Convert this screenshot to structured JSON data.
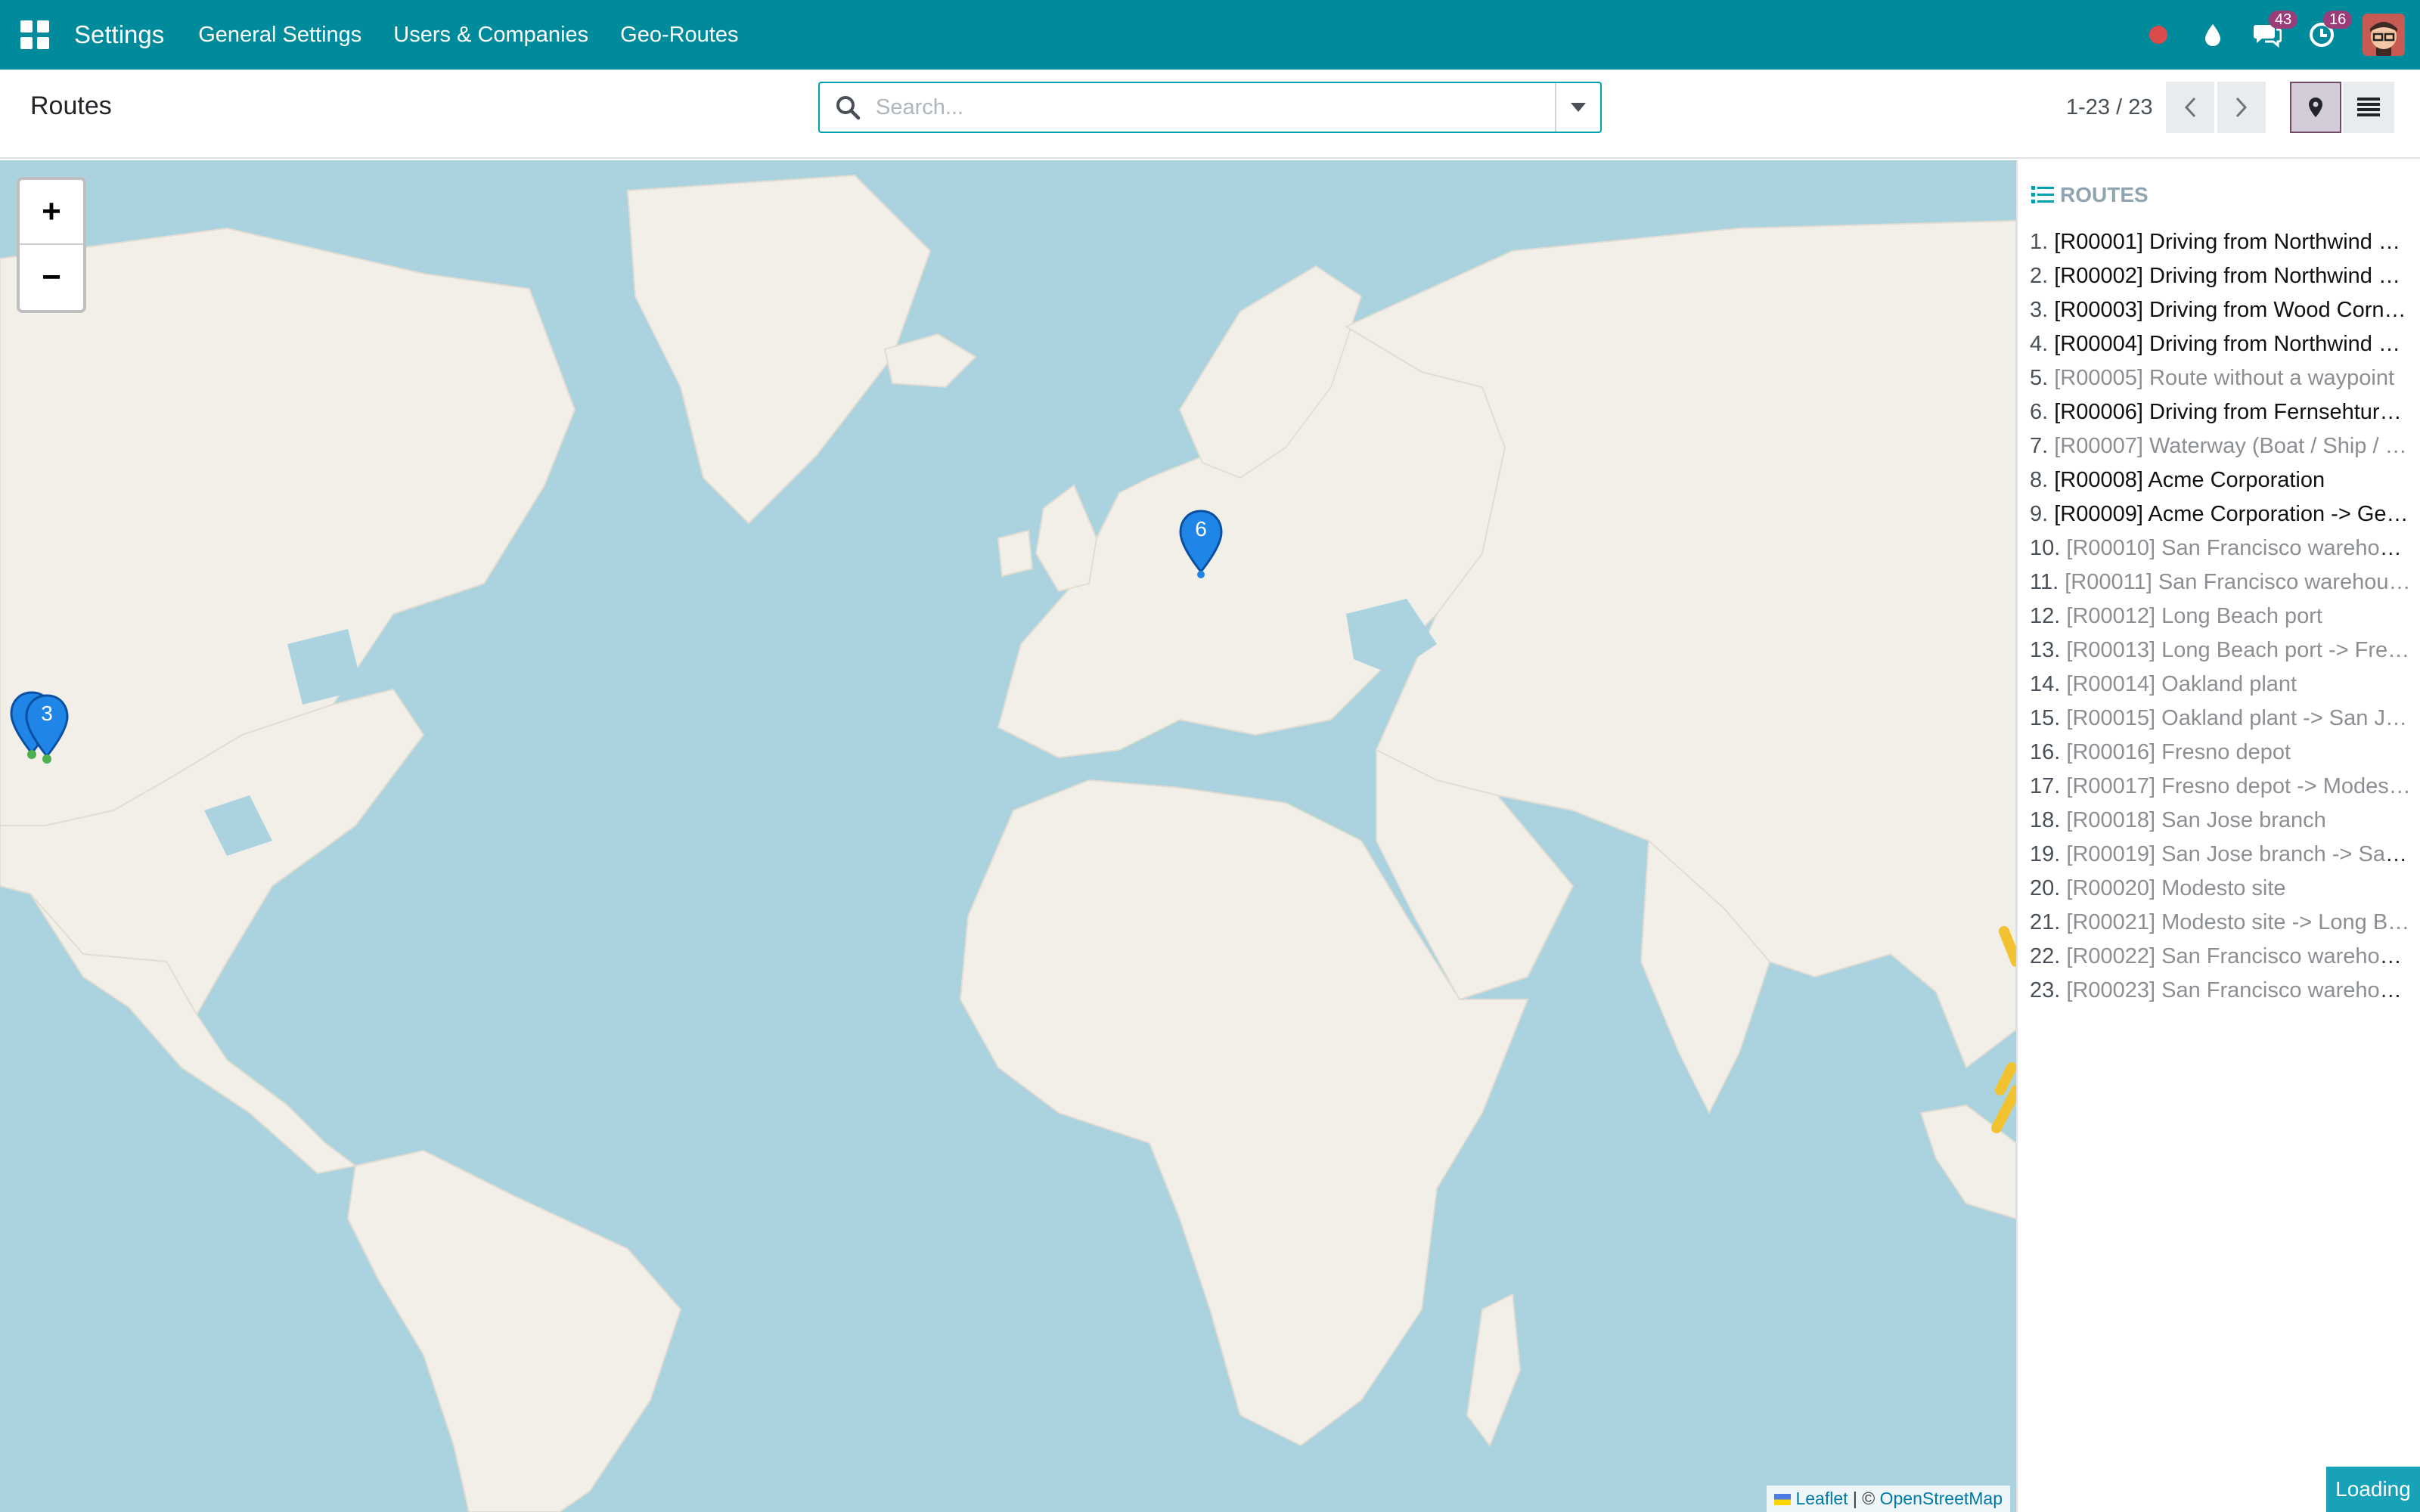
{
  "navbar": {
    "brand": "Settings",
    "menu": [
      "General Settings",
      "Users & Companies",
      "Geo-Routes"
    ],
    "messages_badge": "43",
    "activities_badge": "16",
    "color": "#008b9c"
  },
  "control_panel": {
    "title": "Routes",
    "search_placeholder": "Search...",
    "pager": "1-23 / 23"
  },
  "map": {
    "zoom_in": "+",
    "zoom_out": "−",
    "attribution": {
      "leaflet": "Leaflet",
      "separator": "|",
      "copyright": "©",
      "osm": "OpenStreetMap"
    },
    "markers": [
      {
        "label": "6",
        "place": "Germany"
      },
      {
        "label": "3",
        "place": "California"
      }
    ]
  },
  "sidebar": {
    "header": "ROUTES",
    "routes": [
      {
        "num": "1.",
        "name": "[R00001] Driving from Northwind …",
        "state": "active"
      },
      {
        "num": "2.",
        "name": "[R00002] Driving from Northwind …",
        "state": "active"
      },
      {
        "num": "3.",
        "name": "[R00003] Driving from Wood Corn…",
        "state": "active"
      },
      {
        "num": "4.",
        "name": "[R00004] Driving from Northwind …",
        "state": "active"
      },
      {
        "num": "5.",
        "name": "[R00005] Route without a waypoint",
        "state": "muted"
      },
      {
        "num": "6.",
        "name": "[R00006] Driving from Fernsehtur…",
        "state": "active"
      },
      {
        "num": "7.",
        "name": "[R00007] Waterway (Boat / Ship / …",
        "state": "muted"
      },
      {
        "num": "8.",
        "name": "[R00008] Acme Corporation",
        "state": "active"
      },
      {
        "num": "9.",
        "name": "[R00009] Acme Corporation -> Ge…",
        "state": "active"
      },
      {
        "num": "10.",
        "name": "[R00010] San Francisco warehou…",
        "state": "muted"
      },
      {
        "num": "11.",
        "name": "[R00011] San Francisco warehou…",
        "state": "muted"
      },
      {
        "num": "12.",
        "name": "[R00012] Long Beach port",
        "state": "muted"
      },
      {
        "num": "13.",
        "name": "[R00013] Long Beach port -> Fre…",
        "state": "muted"
      },
      {
        "num": "14.",
        "name": "[R00014] Oakland plant",
        "state": "muted"
      },
      {
        "num": "15.",
        "name": "[R00015] Oakland plant -> San J…",
        "state": "muted"
      },
      {
        "num": "16.",
        "name": "[R00016] Fresno depot",
        "state": "muted"
      },
      {
        "num": "17.",
        "name": "[R00017] Fresno depot -> Modes…",
        "state": "muted"
      },
      {
        "num": "18.",
        "name": "[R00018] San Jose branch",
        "state": "muted"
      },
      {
        "num": "19.",
        "name": "[R00019] San Jose branch -> San…",
        "state": "muted"
      },
      {
        "num": "20.",
        "name": "[R00020] Modesto site",
        "state": "muted"
      },
      {
        "num": "21.",
        "name": "[R00021] Modesto site -> Long B…",
        "state": "muted"
      },
      {
        "num": "22.",
        "name": "[R00022] San Francisco warehou…",
        "state": "muted"
      },
      {
        "num": "23.",
        "name": "[R00023] San Francisco warehou…",
        "state": "muted"
      }
    ]
  },
  "status": {
    "loading": "Loading"
  }
}
